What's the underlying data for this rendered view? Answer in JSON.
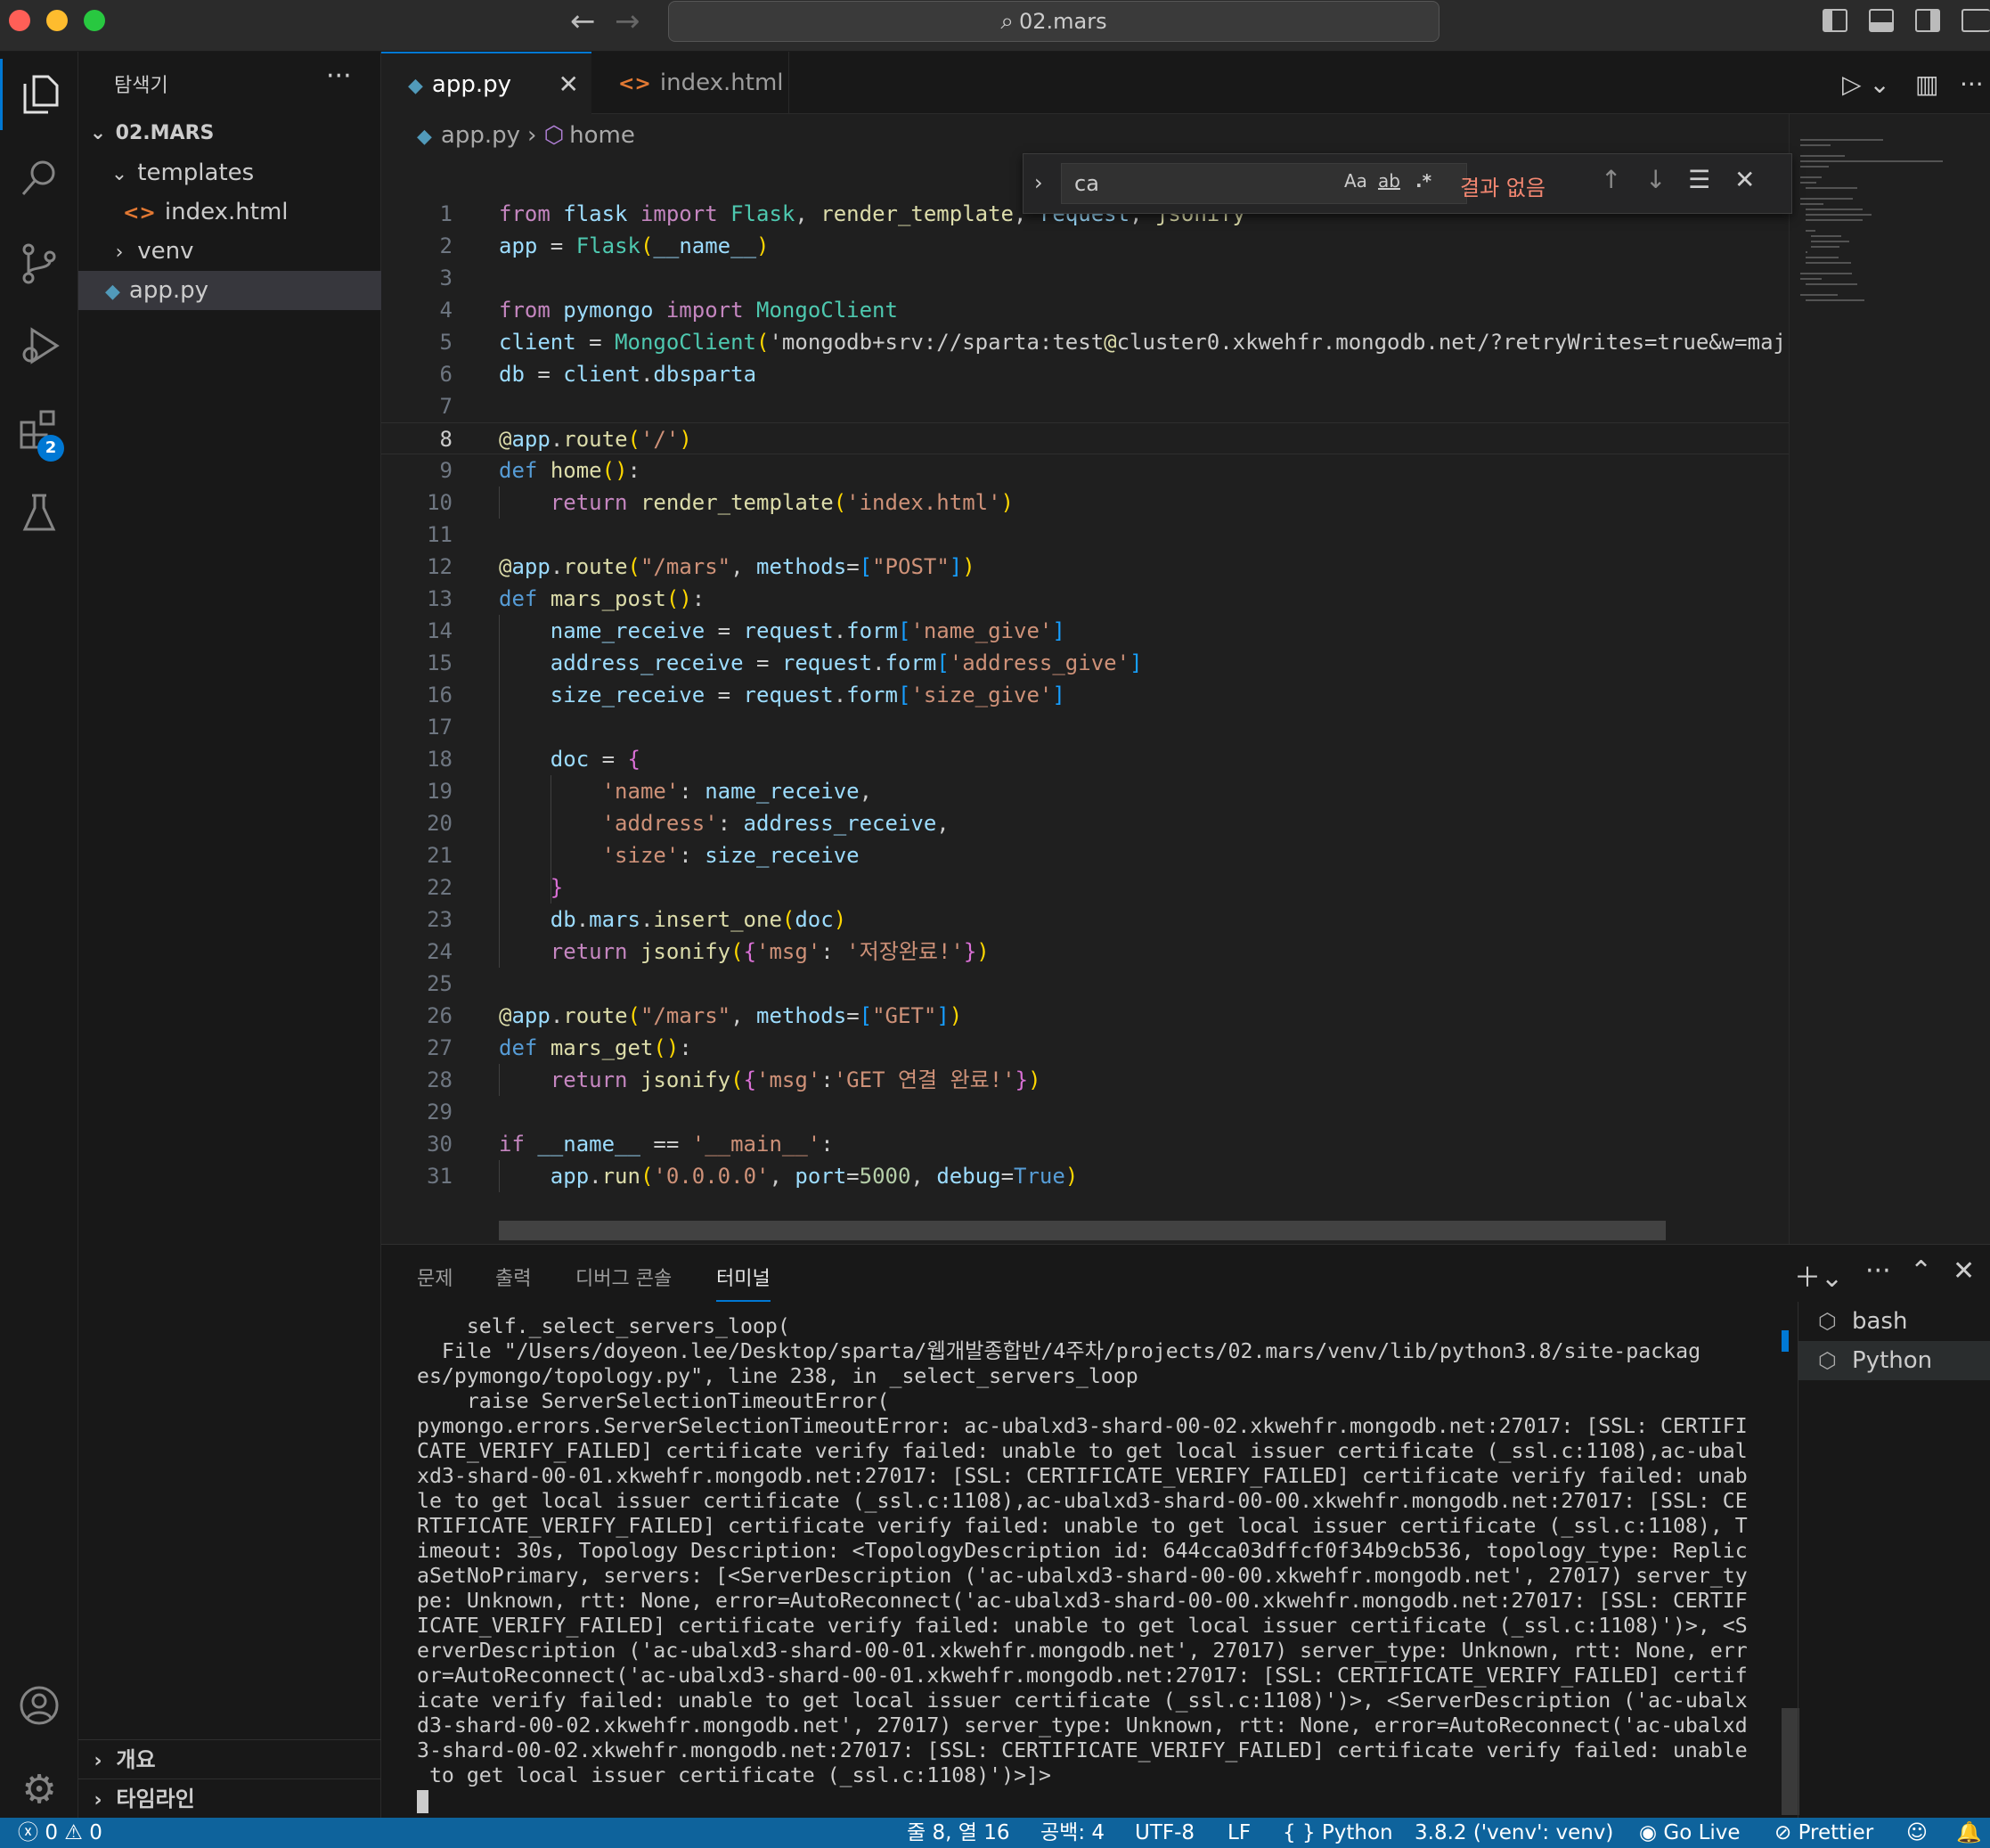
{
  "window": {
    "title": "02.mars"
  },
  "colors": {
    "accent": "#0078d4",
    "status_bar": "#0e639c",
    "find_no_result": "#f48771"
  },
  "activity_bar": {
    "items": [
      "files-icon",
      "search-icon",
      "source-control-icon",
      "run-debug-icon",
      "extensions-icon",
      "testing-icon"
    ],
    "extensions_badge": "2",
    "bottom": [
      "account-icon",
      "settings-gear-icon"
    ]
  },
  "sidebar": {
    "title": "탐색기",
    "more": "···",
    "root": "02.MARS",
    "tree": [
      {
        "label": "templates",
        "type": "folder",
        "expanded": true
      },
      {
        "label": "index.html",
        "type": "html"
      },
      {
        "label": "venv",
        "type": "folder",
        "expanded": false
      },
      {
        "label": "app.py",
        "type": "python",
        "selected": true
      }
    ],
    "footer": [
      "개요",
      "타임라인"
    ]
  },
  "tabs": [
    {
      "label": "app.py",
      "active": true
    },
    {
      "label": "index.html",
      "active": false
    }
  ],
  "breadcrumb": {
    "file": "app.py",
    "symbol": "home"
  },
  "find": {
    "query": "ca",
    "opt_case": "Aa",
    "opt_word": "ab",
    "opt_regex": ".*",
    "result": "결과 없음"
  },
  "code": {
    "current_line": 8,
    "lines": [
      "from flask import Flask, render_template, request, jsonify",
      "app = Flask(__name__)",
      "",
      "from pymongo import MongoClient",
      "client = MongoClient('mongodb+srv://sparta:test@cluster0.xkwehfr.mongodb.net/?retryWrites=true&w=maj",
      "db = client.dbsparta",
      "",
      "@app.route('/')",
      "def home():",
      "    return render_template('index.html')",
      "",
      "@app.route(\"/mars\", methods=[\"POST\"])",
      "def mars_post():",
      "    name_receive = request.form['name_give']",
      "    address_receive = request.form['address_give']",
      "    size_receive = request.form['size_give']",
      "",
      "    doc = {",
      "        'name': name_receive,",
      "        'address': address_receive,",
      "        'size': size_receive",
      "    }",
      "    db.mars.insert_one(doc)",
      "    return jsonify({'msg': '저장완료!'})",
      "",
      "@app.route(\"/mars\", methods=[\"GET\"])",
      "def mars_get():",
      "    return jsonify({'msg':'GET 연결 완료!'})",
      "",
      "if __name__ == '__main__':",
      "    app.run('0.0.0.0', port=5000, debug=True)"
    ]
  },
  "panel": {
    "tabs": [
      "문제",
      "출력",
      "디버그 콘솔",
      "터미널"
    ],
    "active_tab": "터미널",
    "terminal_lines": [
      "    self._select_servers_loop(",
      "  File \"/Users/doyeon.lee/Desktop/sparta/웹개발종합반/4주차/projects/02.mars/venv/lib/python3.8/site-packag",
      "es/pymongo/topology.py\", line 238, in _select_servers_loop",
      "    raise ServerSelectionTimeoutError(",
      "pymongo.errors.ServerSelectionTimeoutError: ac-ubalxd3-shard-00-02.xkwehfr.mongodb.net:27017: [SSL: CERTIFI",
      "CATE_VERIFY_FAILED] certificate verify failed: unable to get local issuer certificate (_ssl.c:1108),ac-ubal",
      "xd3-shard-00-01.xkwehfr.mongodb.net:27017: [SSL: CERTIFICATE_VERIFY_FAILED] certificate verify failed: unab",
      "le to get local issuer certificate (_ssl.c:1108),ac-ubalxd3-shard-00-00.xkwehfr.mongodb.net:27017: [SSL: CE",
      "RTIFICATE_VERIFY_FAILED] certificate verify failed: unable to get local issuer certificate (_ssl.c:1108), T",
      "imeout: 30s, Topology Description: <TopologyDescription id: 644cca03dffcf0f34b9cb536, topology_type: Replic",
      "aSetNoPrimary, servers: [<ServerDescription ('ac-ubalxd3-shard-00-00.xkwehfr.mongodb.net', 27017) server_ty",
      "pe: Unknown, rtt: None, error=AutoReconnect('ac-ubalxd3-shard-00-00.xkwehfr.mongodb.net:27017: [SSL: CERTIF",
      "ICATE_VERIFY_FAILED] certificate verify failed: unable to get local issuer certificate (_ssl.c:1108)')>, <S",
      "erverDescription ('ac-ubalxd3-shard-00-01.xkwehfr.mongodb.net', 27017) server_type: Unknown, rtt: None, err",
      "or=AutoReconnect('ac-ubalxd3-shard-00-01.xkwehfr.mongodb.net:27017: [SSL: CERTIFICATE_VERIFY_FAILED] certif",
      "icate verify failed: unable to get local issuer certificate (_ssl.c:1108)')>, <ServerDescription ('ac-ubalx",
      "d3-shard-00-02.xkwehfr.mongodb.net', 27017) server_type: Unknown, rtt: None, error=AutoReconnect('ac-ubalxd",
      "3-shard-00-02.xkwehfr.mongodb.net:27017: [SSL: CERTIFICATE_VERIFY_FAILED] certificate verify failed: unable",
      " to get local issuer certificate (_ssl.c:1108)')>]>"
    ],
    "terminals": [
      {
        "label": "bash",
        "active": false
      },
      {
        "label": "Python",
        "active": true
      }
    ]
  },
  "status_bar": {
    "errors": "0",
    "warnings": "0",
    "position": "줄 8, 열 16",
    "indent": "공백: 4",
    "encoding": "UTF-8",
    "eol": "LF",
    "language": "Python",
    "interpreter": "3.8.2 ('venv': venv)",
    "go_live": "Go Live",
    "prettier": "Prettier"
  }
}
